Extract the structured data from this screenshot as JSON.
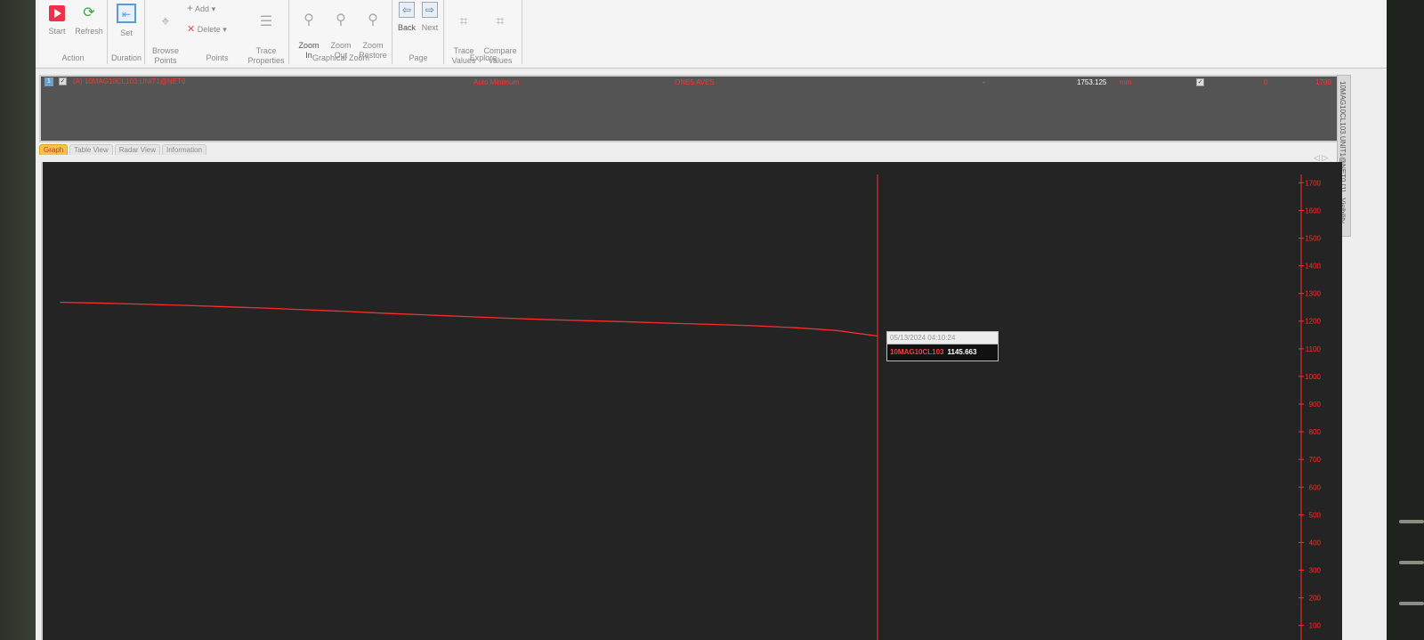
{
  "ribbon": {
    "action": {
      "label": "Action",
      "start": "Start",
      "refresh": "Refresh"
    },
    "duration": {
      "label": "Duration",
      "set": "Set"
    },
    "points": {
      "label": "Points",
      "browse": "Browse\nPoints",
      "add": "Add",
      "delete": "Delete",
      "trace_properties": "Trace\nProperties"
    },
    "graphical_zoom": {
      "label": "Graphical Zoom",
      "zoom_in": "Zoom\nIn",
      "zoom_out": "Zoom\nOut",
      "zoom_restore": "Zoom\nRestore"
    },
    "page": {
      "label": "Page",
      "back": "Back",
      "next": "Next"
    },
    "explore": {
      "label": "Explore",
      "trace_values": "Trace\nValues",
      "compare_values": "Compare\nValues"
    }
  },
  "trace": {
    "index": "1",
    "name": "(A) 10MAG10CL103.UNIT1@NET0",
    "mode": "Auto Minimum",
    "status": "ONE5 AVES",
    "dash": "-",
    "value": "1753.125",
    "unit": "mm",
    "scale_min": "0",
    "scale_max": "1700"
  },
  "side_tab": {
    "text": "10MAG10CL103.UNIT1@NET0 [1]",
    "visibility": "Visibility"
  },
  "view_tabs": [
    "Graph",
    "Table View",
    "Radar View",
    "Information"
  ],
  "nav_arrows": "◁ ▷",
  "tooltip": {
    "time": "05/13/2024 04:10:24",
    "point": "10MAG10CL103",
    "value": "1145.663"
  },
  "colors": {
    "trace": "#ff2b2b",
    "background": "#242424",
    "accent_tab": "#f3c24a"
  },
  "chart_data": {
    "type": "line",
    "title": "",
    "xlabel": "",
    "ylabel": "",
    "ylim": [
      70,
      1730
    ],
    "y_ticks": [
      1700,
      1600,
      1500,
      1400,
      1300,
      1200,
      1100,
      1000,
      900,
      800,
      700,
      600,
      500,
      400,
      300,
      200,
      100
    ],
    "grid": false,
    "series": [
      {
        "x": [
          0,
          0.05,
          0.1,
          0.15,
          0.2,
          0.25,
          0.3,
          0.35,
          0.4,
          0.45,
          0.5,
          0.55,
          0.6,
          0.65,
          0.7,
          0.75,
          0.8,
          0.85,
          0.9,
          0.95,
          1.0
        ],
        "values": [
          1268,
          1265,
          1261,
          1257,
          1252,
          1247,
          1241,
          1235,
          1228,
          1222,
          1216,
          1210,
          1205,
          1201,
          1197,
          1192,
          1188,
          1183,
          1176,
          1166,
          1146
        ]
      }
    ],
    "cursor_x": 1.0
  }
}
